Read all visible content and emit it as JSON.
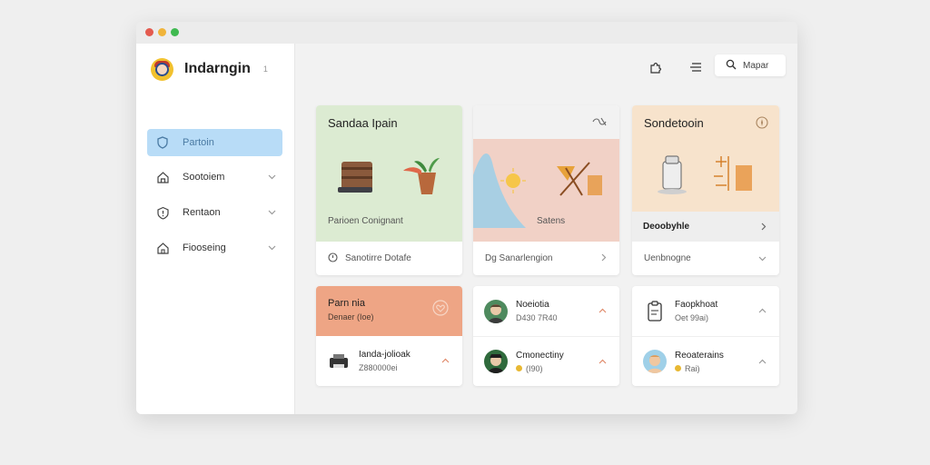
{
  "app": {
    "name": "Indarngin",
    "badge": "1"
  },
  "sidebar": {
    "items": [
      {
        "label": "Partoin",
        "icon": "shield-icon",
        "active": true
      },
      {
        "label": "Sootoiem",
        "icon": "house-icon",
        "active": false
      },
      {
        "label": "Rentaon",
        "icon": "info-icon",
        "active": false
      },
      {
        "label": "Fiooseing",
        "icon": "home-icon",
        "active": false
      }
    ]
  },
  "toolbar": {
    "puzzle_icon": "puzzle-icon",
    "menu_icon": "menu-lines-icon",
    "search_label": "Mapar"
  },
  "cards": [
    {
      "title": "Sandaa Ipain",
      "caption": "Parioen Conignant",
      "footer": "Sanotirre Dotafe",
      "hero_color": "#dcebd2"
    },
    {
      "title": "",
      "caption": "Satens",
      "footer": "Dg  Sanarlengion",
      "hero_color": "#f1d1c6"
    },
    {
      "title": "Sondetooin",
      "caption": "Deoobyhle",
      "footer": "Uenbnogne",
      "hero_color": "#f7e3cc"
    }
  ],
  "mini_left": {
    "top": {
      "title": "Parn nia",
      "sub": "Denaer (Ioe)",
      "color": "#eea585"
    },
    "row": {
      "title": "Ianda-jolioak",
      "sub": "Z880000ei"
    }
  },
  "mini_mid": [
    {
      "title": "Noeiotia",
      "sub": "D430 7R40"
    },
    {
      "title": "Cmonectiny",
      "sub": "(I90)"
    }
  ],
  "mini_right": [
    {
      "title": "Faopkhoat",
      "sub": "Oet 99ai)"
    },
    {
      "title": "Reoaterains",
      "sub": "Rai)"
    }
  ],
  "colors": {
    "accent_blue": "#b8dcf7",
    "peach": "#eea585",
    "close_red": "#e45b4f",
    "close_yellow": "#f0b43a",
    "close_green": "#3fb950"
  }
}
